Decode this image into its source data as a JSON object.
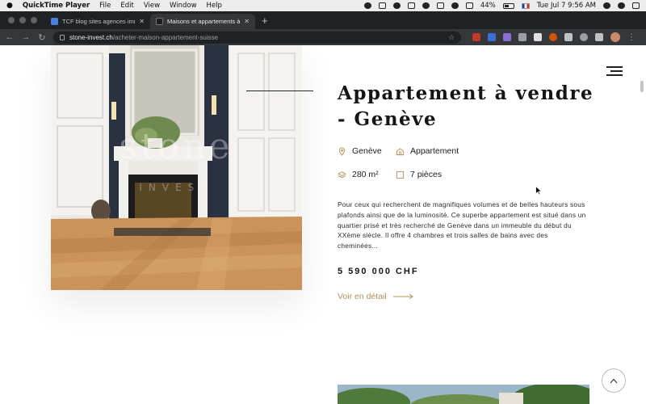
{
  "menubar": {
    "app_name": "QuickTime Player",
    "items": [
      "File",
      "Edit",
      "View",
      "Window",
      "Help"
    ],
    "battery": "44%",
    "clock": "Tue Jul 7  9:56 AM"
  },
  "tabs": [
    {
      "title": "TCF blog sites agences immo",
      "active": false
    },
    {
      "title": "Maisons et appartements à ach",
      "active": true
    }
  ],
  "toolbar": {
    "url_host": "stone-invest.ch",
    "url_path": "/acheter-maison-appartement-suisse"
  },
  "listing": {
    "title": "Appartement à vendre - Genève",
    "location": "Genève",
    "type": "Appartement",
    "surface": "280 m²",
    "rooms": "7 pièces",
    "description": "Pour ceux qui recherchent de magnifiques volumes et de belles hauteurs sous plafonds ainsi que de la luminosité. Ce superbe appartement est situé dans un quartier prisé et très recherché de Genève dans un immeuble du début du XXème siècle. Il offre 4 chambres et trois salles de bains avec des cheminées...",
    "price": "5 590 000 CHF",
    "cta": "Voir en détail",
    "watermark": "stone INVEST"
  },
  "colors": {
    "accent_gold": "#b3905a",
    "text_dark": "#151515",
    "chrome_dark": "#202124",
    "chrome_toolbar": "#35363a"
  }
}
